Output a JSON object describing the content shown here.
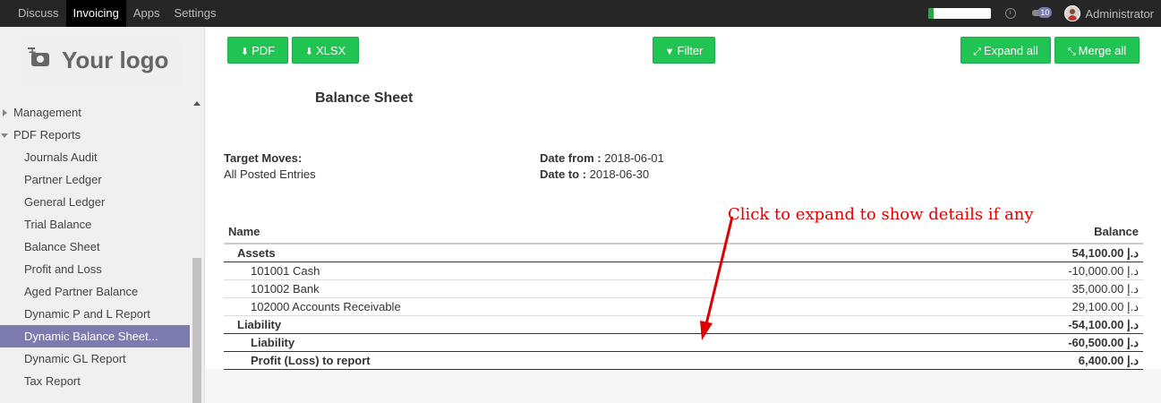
{
  "topbar": {
    "menu": [
      "Discuss",
      "Invoicing",
      "Apps",
      "Settings"
    ],
    "active_menu": "Invoicing",
    "progress_fraction": 0.08,
    "message_count": "10",
    "user_name": "Administrator"
  },
  "sidebar": {
    "logo_text": "Your logo",
    "items": [
      {
        "label": "Management",
        "type": "group",
        "expanded": false
      },
      {
        "label": "PDF Reports",
        "type": "group",
        "expanded": true
      },
      {
        "label": "Journals Audit",
        "type": "item"
      },
      {
        "label": "Partner Ledger",
        "type": "item"
      },
      {
        "label": "General Ledger",
        "type": "item"
      },
      {
        "label": "Trial Balance",
        "type": "item"
      },
      {
        "label": "Balance Sheet",
        "type": "item"
      },
      {
        "label": "Profit and Loss",
        "type": "item"
      },
      {
        "label": "Aged Partner Balance",
        "type": "item"
      },
      {
        "label": "Dynamic P and L Report",
        "type": "item"
      },
      {
        "label": "Dynamic Balance Sheet...",
        "type": "item",
        "active": true
      },
      {
        "label": "Dynamic GL Report",
        "type": "item"
      },
      {
        "label": "Tax Report",
        "type": "item"
      }
    ]
  },
  "toolbar": {
    "pdf_label": "PDF",
    "xlsx_label": "XLSX",
    "filter_label": "Filter",
    "expand_label": "Expand all",
    "merge_label": "Merge all"
  },
  "report": {
    "title": "Balance Sheet",
    "target_moves_label": "Target Moves:",
    "target_moves_value": "All Posted Entries",
    "date_from_label": "Date from :",
    "date_from_value": "2018-06-01",
    "date_to_label": "Date to :",
    "date_to_value": "2018-06-30",
    "columns": [
      "Name",
      "Balance"
    ],
    "rows": [
      {
        "name": "Assets",
        "balance": "54,100.00 د.إ",
        "level": 0,
        "bold": true
      },
      {
        "name": "101001 Cash",
        "balance": "-10,000.00 د.إ",
        "level": 1,
        "bold": false
      },
      {
        "name": "101002 Bank",
        "balance": "35,000.00 د.إ",
        "level": 1,
        "bold": false
      },
      {
        "name": "102000 Accounts Receivable",
        "balance": "29,100.00 د.إ",
        "level": 1,
        "bold": false
      },
      {
        "name": "Liability",
        "balance": "-54,100.00 د.إ",
        "level": 0,
        "bold": true
      },
      {
        "name": "Liability",
        "balance": "-60,500.00 د.إ",
        "level": 1,
        "bold": true
      },
      {
        "name": "Profit (Loss) to report",
        "balance": "6,400.00 د.إ",
        "level": 1,
        "bold": true
      }
    ]
  },
  "annotation": {
    "text": "Click to expand to show details if any",
    "color": "#e00000"
  },
  "colors": {
    "accent": "#21c453",
    "sidebar_active": "#7c7bad",
    "topbar": "#262626"
  }
}
